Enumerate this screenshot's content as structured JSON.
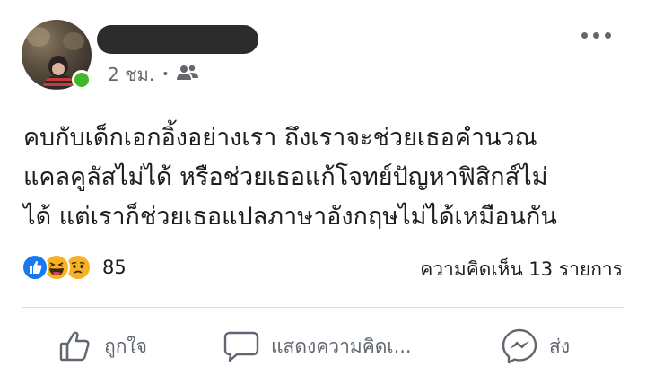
{
  "post": {
    "time": "2 ชม.",
    "audience_icon": "friends-icon",
    "lines": [
      "คบกับเด็กเอกอิ้งอย่างเรา ถึงเราจะช่วยเธอคำนวณ",
      "แคลคูลัสไม่ได้ หรือช่วยเธอแก้โจทย์ปัญหาฟิสิกส์ไม่",
      "ได้ แต่เราก็ช่วยเธอแปลภาษาอังกฤษไม่ได้เหมือนกัน"
    ],
    "reactions": {
      "types": [
        "like",
        "haha",
        "sad"
      ],
      "count": "85"
    },
    "comments_label": "ความคิดเห็น 13 รายการ",
    "actions": {
      "like": "ถูกใจ",
      "comment": "แสดงความคิดเ...",
      "share": "ส่ง"
    }
  },
  "colors": {
    "online": "#42b72a",
    "like_blue": "#1877f2",
    "emoji_yellow": "#f7b125",
    "meta_gray": "#65676b"
  }
}
